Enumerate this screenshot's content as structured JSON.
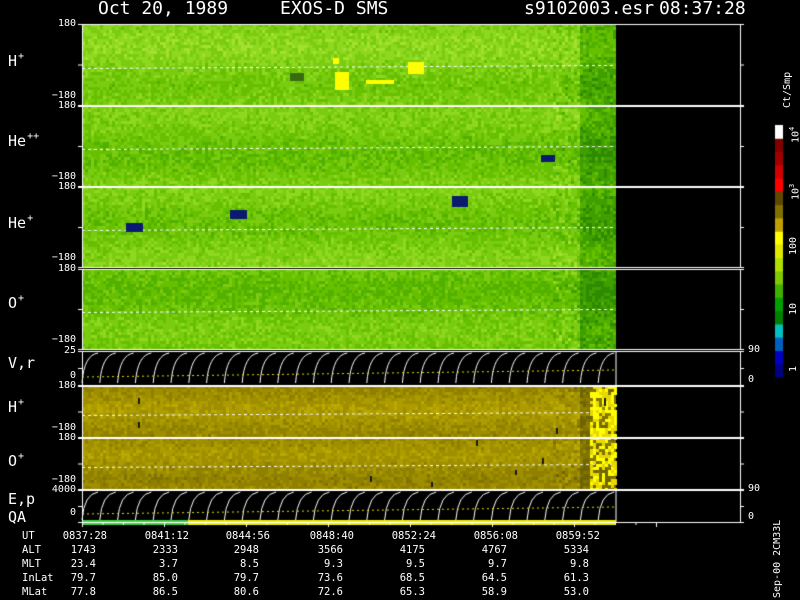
{
  "header": {
    "date": "Oct 20, 1989",
    "instrument": "EXOS-D SMS",
    "filename": "s9102003.esr",
    "time": "08:37:28"
  },
  "panels": [
    {
      "id": "hplus",
      "species": "H",
      "charge": "+",
      "tick_top": "180",
      "tick_bottom": "−180",
      "colormap": "green"
    },
    {
      "id": "heplusplus",
      "species": "He",
      "charge": "++",
      "tick_top": "180",
      "tick_bottom": "−180",
      "colormap": "green"
    },
    {
      "id": "heplus",
      "species": "He",
      "charge": "+",
      "tick_top": "180",
      "tick_bottom": "−180",
      "colormap": "green"
    },
    {
      "id": "oplus",
      "species": "O",
      "charge": "+",
      "tick_top": "180",
      "tick_bottom": "−180",
      "colormap": "green"
    },
    {
      "id": "vr",
      "label": "V,r",
      "tick_top": "25",
      "tick_bottom": "0",
      "right_top": "90",
      "right_bottom": "0",
      "kind": "line"
    },
    {
      "id": "hplus2",
      "species": "H",
      "charge": "+",
      "tick_top": "180",
      "tick_bottom": "−180",
      "colormap": "olive"
    },
    {
      "id": "oplus2",
      "species": "O",
      "charge": "+",
      "tick_top": "180",
      "tick_bottom": "−180",
      "colormap": "olive"
    },
    {
      "id": "ep",
      "label": "E,p",
      "tick_top": "4000",
      "tick_bottom": "0",
      "right_top": "90",
      "right_bottom": "0",
      "kind": "line"
    }
  ],
  "qa_label": "QA",
  "colorbar": {
    "unit": "Ct/Smp",
    "ticks": [
      "1",
      "10",
      "100",
      "10^3",
      "10^4"
    ],
    "colors": [
      "#000080",
      "#0000c0",
      "#0060c0",
      "#00c0c0",
      "#008000",
      "#00a000",
      "#40b000",
      "#80c800",
      "#b0e000",
      "#e0e800",
      "#ffff00",
      "#c0a000",
      "#807000",
      "#604800",
      "#ff0000",
      "#d00000",
      "#a00000",
      "#800000",
      "#ffffff"
    ]
  },
  "version_label": "Sep-00 2CM33L",
  "ephemeris": {
    "rows": [
      {
        "name": "UT",
        "values": [
          "0837:28",
          "0841:12",
          "0844:56",
          "0848:40",
          "0852:24",
          "0856:08",
          "0859:52"
        ]
      },
      {
        "name": "ALT",
        "values": [
          "1743",
          "2333",
          "2948",
          "3566",
          "4175",
          "4767",
          "5334"
        ]
      },
      {
        "name": "MLT",
        "values": [
          "23.4",
          "3.7",
          "8.5",
          "9.3",
          "9.5",
          "9.7",
          "9.8"
        ]
      },
      {
        "name": "InLat",
        "values": [
          "79.7",
          "85.0",
          "79.7",
          "73.6",
          "68.5",
          "64.5",
          "61.3"
        ]
      },
      {
        "name": "MLat",
        "values": [
          "77.8",
          "86.5",
          "80.6",
          "72.6",
          "65.3",
          "58.9",
          "53.0"
        ]
      }
    ]
  },
  "chart_data": {
    "type": "heatmap",
    "title": "Oct 20, 1989   EXOS-D SMS",
    "xlabel": "UT",
    "x_ticks": [
      "0837:28",
      "0841:12",
      "0844:56",
      "0848:40",
      "0852:24",
      "0856:08",
      "0859:52"
    ],
    "series": [
      {
        "name": "H+",
        "ylim": [
          -180,
          180
        ]
      },
      {
        "name": "He++",
        "ylim": [
          -180,
          180
        ]
      },
      {
        "name": "He+",
        "ylim": [
          -180,
          180
        ]
      },
      {
        "name": "O+",
        "ylim": [
          -180,
          180
        ]
      },
      {
        "name": "V,r",
        "ylim": [
          0,
          25
        ]
      },
      {
        "name": "H+",
        "ylim": [
          -180,
          180
        ]
      },
      {
        "name": "O+",
        "ylim": [
          -180,
          180
        ]
      },
      {
        "name": "E,p",
        "ylim": [
          0,
          4000
        ]
      }
    ],
    "colorbar_unit": "Ct/Smp",
    "colorbar_range": [
      1,
      10000
    ],
    "colorbar_scale": "log"
  }
}
